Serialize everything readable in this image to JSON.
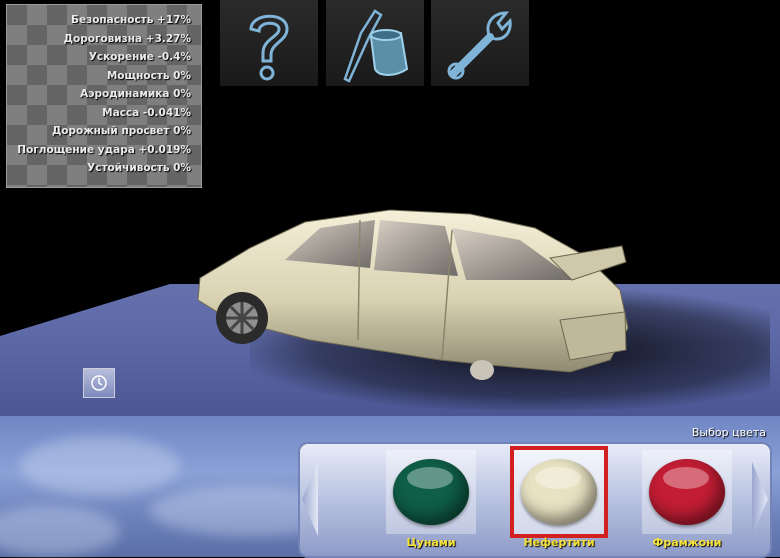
{
  "stats": [
    "Безопасность +17%",
    "Дороговизна +3.27%",
    "Ускорение -0.4%",
    "Мощность 0%",
    "Аэродинамика 0%",
    "Масса -0.041%",
    "Дорожный просвет 0%",
    "Поглощение удара +0.019%",
    "Устойчивость 0%"
  ],
  "toolbar": {
    "help_icon": "question-mark-icon",
    "paint_icon": "paint-bucket-icon",
    "tune_icon": "wrench-icon"
  },
  "color_picker": {
    "label": "Выбор цвета",
    "swatches": [
      {
        "name": "Цунами",
        "color": "#0f5e47",
        "selected": false
      },
      {
        "name": "Нефертити",
        "color": "#e8e2c2",
        "selected": true
      },
      {
        "name": "Фрамжони",
        "color": "#c21d34",
        "selected": false
      }
    ]
  },
  "colors": {
    "car_body": "#e6e0c4",
    "selection_outline": "#d21f1f",
    "swatch_label": "#f5e23a"
  }
}
